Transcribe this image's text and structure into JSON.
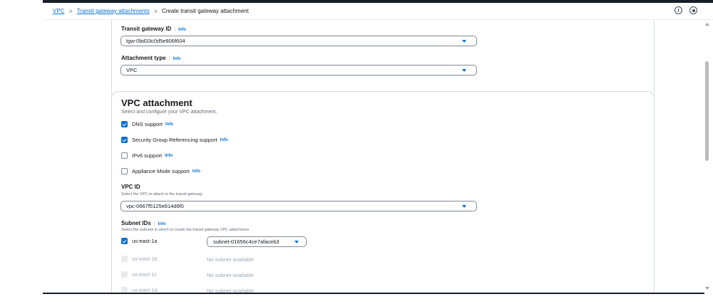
{
  "breadcrumb": {
    "items": [
      "VPC",
      "Transit gateway attachments"
    ],
    "current": "Create transit gateway attachment",
    "separator": ">"
  },
  "top_icons": [
    "info-icon",
    "settings-icon"
  ],
  "details": {
    "tgw_label": "Transit gateway ID",
    "tgw_info": "Info",
    "tgw_value": "tgw-0bd33c0d5e806f604",
    "type_label": "Attachment type",
    "type_info": "Info",
    "type_value": "VPC"
  },
  "vpc_attachment": {
    "title": "VPC attachment",
    "description": "Select and configure your VPC attachment.",
    "options": [
      {
        "label": "DNS support",
        "info": "Info",
        "checked": true
      },
      {
        "label": "Security Group Referencing support",
        "info": "Info",
        "checked": true
      },
      {
        "label": "IPv6 support",
        "info": "Info",
        "checked": false
      },
      {
        "label": "Appliance Mode support",
        "info": "Info",
        "checked": false
      }
    ],
    "vpc_id_label": "VPC ID",
    "vpc_id_desc": "Select the VPC to attach to the transit gateway.",
    "vpc_id_value": "vpc-0667f5125e814d6f0",
    "subnet_label": "Subnet IDs",
    "subnet_info": "Info",
    "subnet_desc": "Select the subnets in which to create the transit gateway VPC attachment.",
    "subnets": [
      {
        "az": "us-east-1a",
        "value": "subnet-01656c4ce7afaceb3",
        "checked": true,
        "disabled": false
      },
      {
        "az": "us-east-1b",
        "value": "No subnet available",
        "checked": false,
        "disabled": true
      },
      {
        "az": "us-east-1c",
        "value": "No subnet available",
        "checked": false,
        "disabled": true
      },
      {
        "az": "us-east-1d",
        "value": "No subnet available",
        "checked": false,
        "disabled": true
      }
    ]
  },
  "colors": {
    "accent": "#0972d3",
    "header_dark": "#161d26",
    "border": "#d5dbdb",
    "muted_text": "#5f6b7a"
  }
}
